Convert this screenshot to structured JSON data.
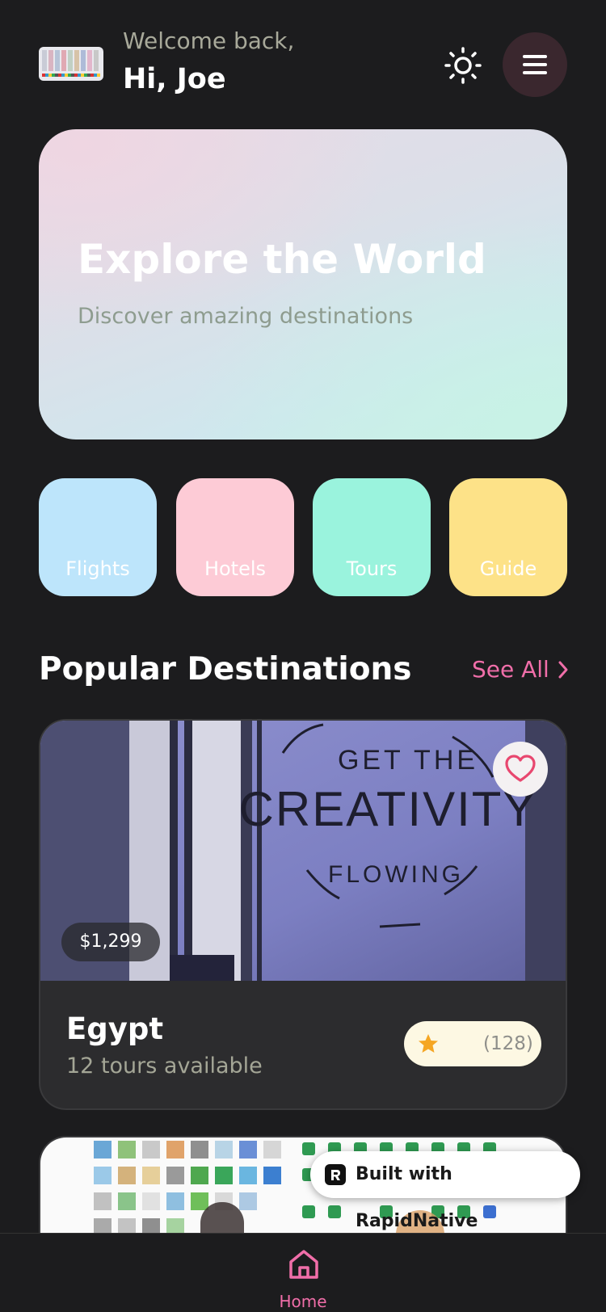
{
  "header": {
    "welcome": "Welcome back,",
    "greeting": "Hi, Joe",
    "theme_icon": "sun-icon",
    "menu_icon": "hamburger-menu-icon"
  },
  "hero": {
    "title": "Explore the World",
    "subtitle": "Discover amazing destinations"
  },
  "categories": [
    {
      "label": "Flights",
      "color": "#bde5fb"
    },
    {
      "label": "Hotels",
      "color": "#fdcbd6"
    },
    {
      "label": "Tours",
      "color": "#9af3dd"
    },
    {
      "label": "Guide",
      "color": "#fde288"
    }
  ],
  "popular": {
    "title": "Popular Destinations",
    "see_all": "See All"
  },
  "destinations": [
    {
      "name": "Egypt",
      "tours": "12 tours available",
      "price": "$1,299",
      "rating_count": "(128)",
      "image_text": "GET THE CREATIVITY FLOWING"
    }
  ],
  "badge": {
    "label": "Built with RapidNative"
  },
  "tabbar": {
    "home_label": "Home"
  },
  "colors": {
    "background": "#1c1c1e",
    "accent": "#f06ea9",
    "card": "#2c2c2e"
  }
}
